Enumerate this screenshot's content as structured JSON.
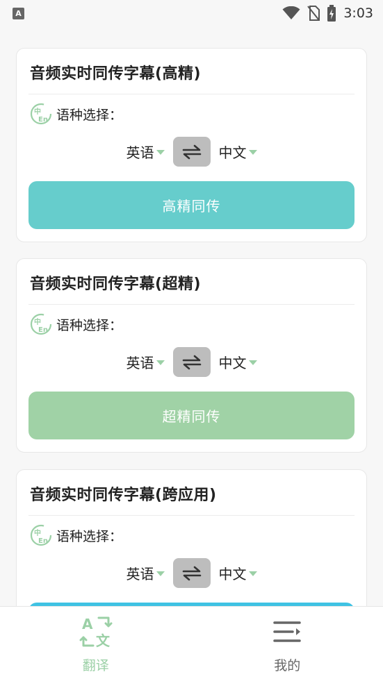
{
  "status_bar": {
    "app_icon_letter": "A",
    "time": "3:03"
  },
  "cards": [
    {
      "title": "音频实时同传字幕(高精)",
      "lang_label": "语种选择：",
      "source_lang": "英语",
      "target_lang": "中文",
      "button_label": "高精同传",
      "button_color": "#66cdcc"
    },
    {
      "title": "音频实时同传字幕(超精)",
      "lang_label": "语种选择：",
      "source_lang": "英语",
      "target_lang": "中文",
      "button_label": "超精同传",
      "button_color": "#a0d2a6"
    },
    {
      "title": "音频实时同传字幕(跨应用)",
      "lang_label": "语种选择：",
      "source_lang": "英语",
      "target_lang": "中文",
      "button_label": "",
      "button_color": "#3fc2e3"
    }
  ],
  "bottom_nav": {
    "items": [
      {
        "label": "翻译",
        "icon": "translate-icon",
        "active": true,
        "color": "#9bd0a6"
      },
      {
        "label": "我的",
        "icon": "menu-icon",
        "active": false,
        "color": "#666666"
      }
    ]
  },
  "colors": {
    "accent_green": "#9bd0a6",
    "swap_bg": "#bdbdbd"
  }
}
